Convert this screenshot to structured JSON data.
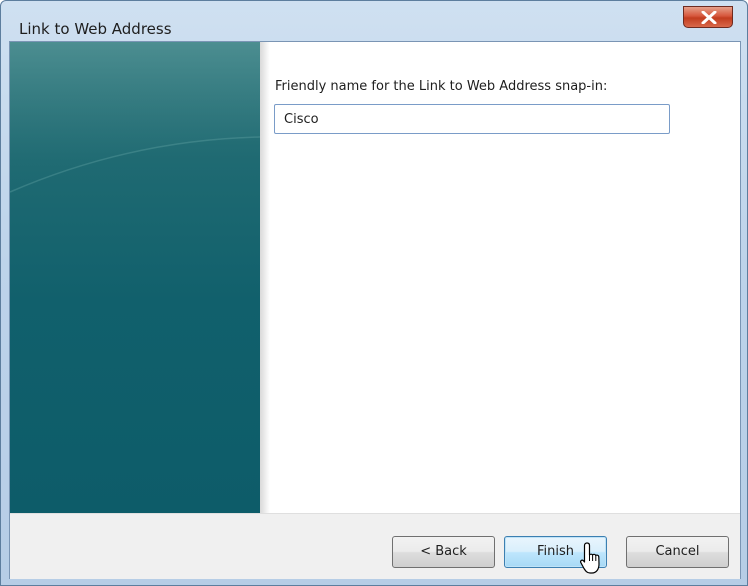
{
  "window": {
    "title": "Link to Web Address",
    "close_glyph": "X"
  },
  "form": {
    "label": "Friendly name for the Link to Web Address snap-in:",
    "name_value": "Cisco"
  },
  "buttons": {
    "back": "< Back",
    "finish": "Finish",
    "cancel": "Cancel"
  },
  "icons": {
    "close": "close-icon",
    "cursor": "mouse-pointer-icon"
  },
  "colors": {
    "banner": "#0d5c69",
    "close_button": "#c23d1f",
    "focused_button": "#3c7fb1"
  }
}
